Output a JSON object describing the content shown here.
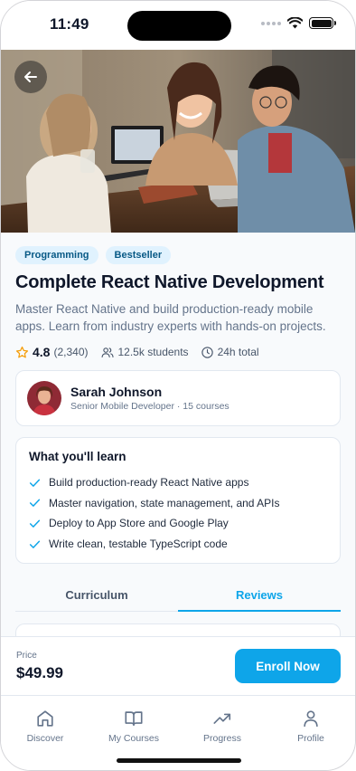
{
  "status_bar": {
    "time": "11:49"
  },
  "hero": {
    "back_icon": "arrow-left-icon"
  },
  "tags": [
    "Programming",
    "Bestseller"
  ],
  "course": {
    "title": "Complete React Native Development",
    "description": "Master React Native and build production-ready mobile apps. Learn from industry experts with hands-on projects.",
    "rating": "4.8",
    "rating_count": "(2,340)",
    "students": "12.5k students",
    "duration": "24h total"
  },
  "instructor": {
    "name": "Sarah Johnson",
    "subtitle": "Senior Mobile Developer · 15 courses"
  },
  "learn": {
    "title": "What you'll learn",
    "items": [
      "Build production-ready React Native apps",
      "Master navigation, state management, and APIs",
      "Deploy to App Store and Google Play",
      "Write clean, testable TypeScript code"
    ]
  },
  "tabs": [
    {
      "label": "Curriculum",
      "active": false
    },
    {
      "label": "Reviews",
      "active": true
    }
  ],
  "price_bar": {
    "label": "Price",
    "value": "$49.99",
    "button": "Enroll Now"
  },
  "bottom_nav": [
    {
      "label": "Discover",
      "icon": "home-icon"
    },
    {
      "label": "My Courses",
      "icon": "book-open-icon"
    },
    {
      "label": "Progress",
      "icon": "trending-up-icon"
    },
    {
      "label": "Profile",
      "icon": "user-icon"
    }
  ],
  "colors": {
    "accent": "#0ea5e9",
    "tag_bg": "#e0f2fe",
    "tag_text": "#075985",
    "star": "#f59e0b"
  }
}
